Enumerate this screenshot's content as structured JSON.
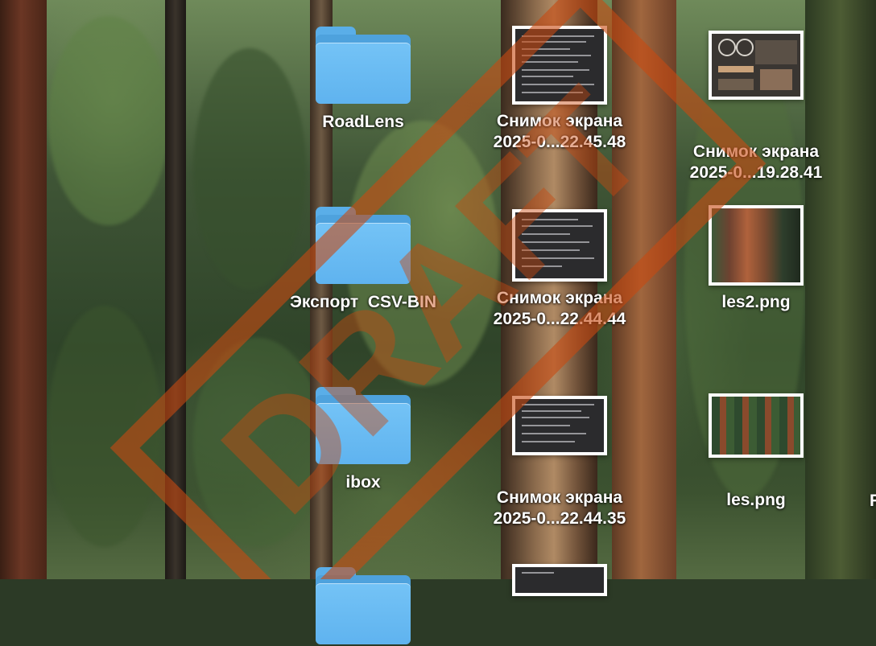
{
  "desktop": {
    "items": [
      {
        "kind": "folder",
        "name": "RoadLens"
      },
      {
        "kind": "screenshot",
        "name_line1": "Снимок экрана",
        "name_line2": "2025-0...22.45.48"
      },
      {
        "kind": "screenshot",
        "name_line1": "Снимок экрана",
        "name_line2": "2025-0...19.28.41"
      },
      {
        "kind": "folder",
        "name": "Экспорт  CSV-BIN"
      },
      {
        "kind": "screenshot",
        "name_line1": "Снимок экрана",
        "name_line2": "2025-0...22.44.44"
      },
      {
        "kind": "image",
        "name": "les2.png"
      },
      {
        "kind": "folder",
        "name": "ibox"
      },
      {
        "kind": "screenshot",
        "name_line1": "Снимок экрана",
        "name_line2": "2025-0...22.44.35"
      },
      {
        "kind": "image",
        "name": "les.png"
      }
    ],
    "partial_label": "R"
  },
  "watermark": {
    "text": "DRAFT",
    "color": "#c84a10"
  },
  "colors": {
    "folder": "#6cbcf3",
    "label": "#ffffff"
  }
}
